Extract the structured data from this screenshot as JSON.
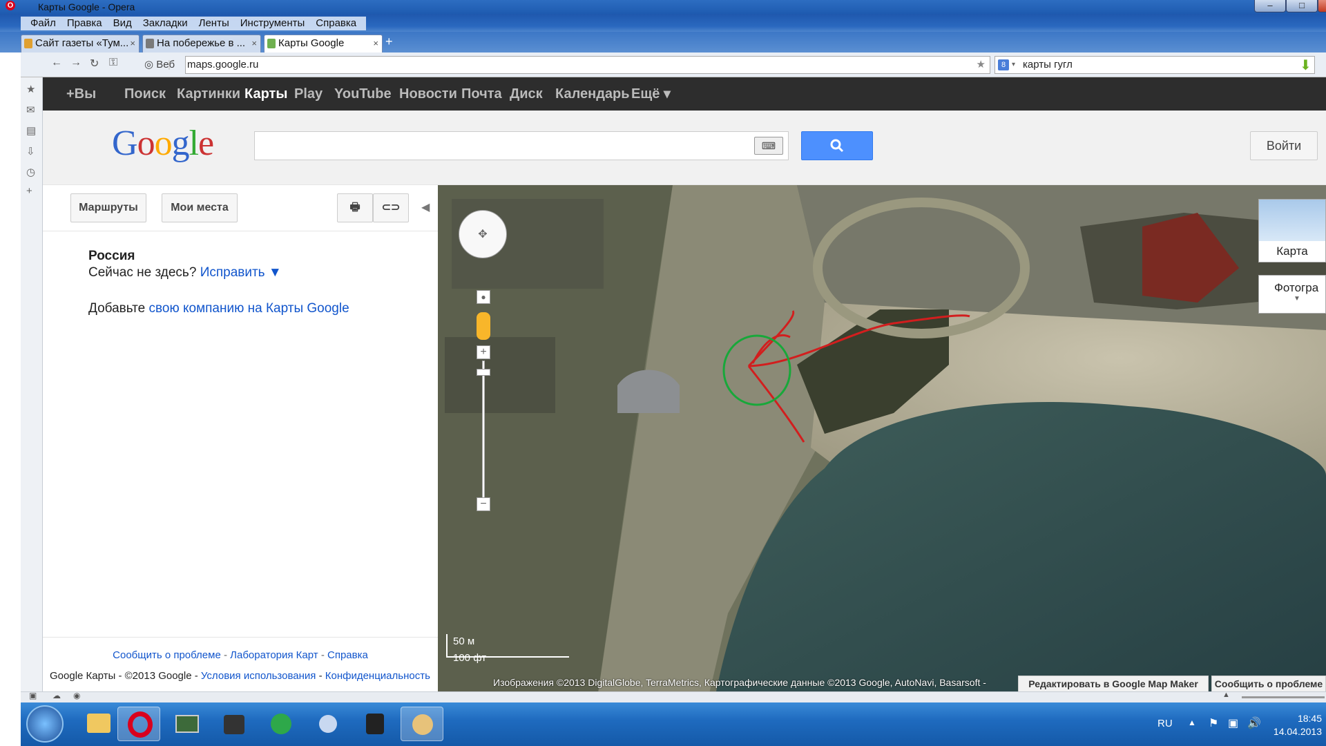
{
  "window": {
    "title": "Карты Google - Opera"
  },
  "menu": [
    "Файл",
    "Правка",
    "Вид",
    "Закладки",
    "Ленты",
    "Инструменты",
    "Справка"
  ],
  "tabs": [
    {
      "label": "Сайт газеты «Тум...",
      "close": "×"
    },
    {
      "label": "На побережье в ...",
      "close": "×"
    },
    {
      "label": "Карты Google",
      "close": "×"
    }
  ],
  "newtab": "+",
  "address": {
    "web_label": "Веб",
    "url": "maps.google.ru",
    "search_value": "карты гугл"
  },
  "gbar": [
    "+Вы",
    "Поиск",
    "Картинки",
    "Карты",
    "Play",
    "YouTube",
    "Новости",
    "Почта",
    "Диск",
    "Календарь",
    "Ещё ▾"
  ],
  "logo": {
    "text": "Google",
    "colors": [
      "#3366cc",
      "#cc3333",
      "#ffaa00",
      "#3366cc",
      "#33aa33",
      "#cc3333"
    ]
  },
  "header": {
    "signin": "Войти",
    "search_icon": "search-icon",
    "kbd_icon": "keyboard-icon"
  },
  "left": {
    "routes": "Маршруты",
    "myplaces": "Мои места",
    "country": "Россия",
    "not_here": "Сейчас не здесь?",
    "fix": "Исправить ▼",
    "add_prefix": "Добавьте",
    "add_link": "свою компанию на Карты Google",
    "footer1": [
      "Сообщить о проблеме",
      "Лаборатория Карт",
      "Справка"
    ],
    "footer2_prefix": "Google Карты - ©2013 Google -",
    "footer2_links": [
      "Условия использования",
      "Конфиденциальность"
    ]
  },
  "map": {
    "type_map": "Карта",
    "type_photo": "Фотогра",
    "scale_m": "50 м",
    "scale_ft": "100 фт",
    "copyright": "Изображения ©2013 DigitalGlobe, TerraMetrics, Картографические данные ©2013 Google, AutoNavi, Basarsoft -",
    "edit": "Редактировать в Google Map Maker",
    "report": "Сообщить о проблеме"
  },
  "taskbar": {
    "lang": "RU",
    "time": "18:45",
    "date": "14.04.2013"
  }
}
